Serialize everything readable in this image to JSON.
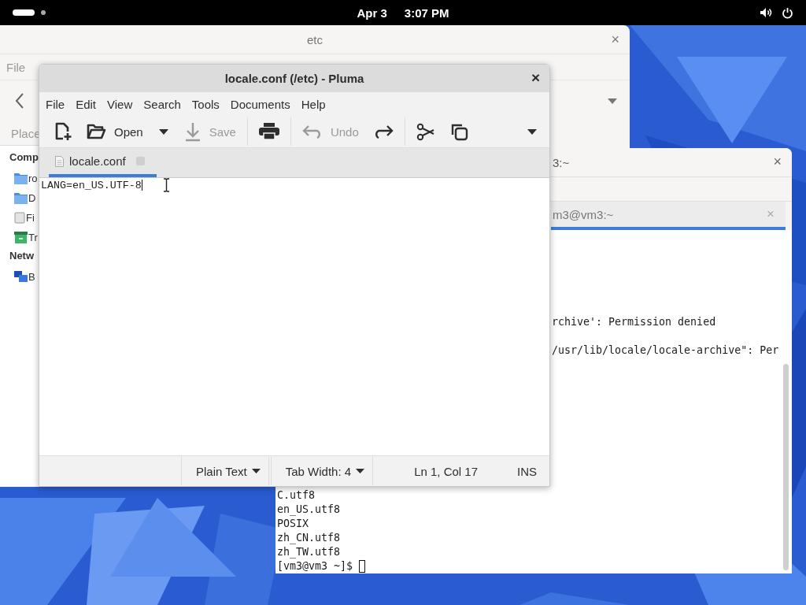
{
  "top_bar": {
    "date": "Apr 3",
    "time": "3:07 PM"
  },
  "close_glyph": "×",
  "file_manager": {
    "title": "etc",
    "menu": [
      "File"
    ],
    "places_label": "Place",
    "sidebar": [
      {
        "kind": "heading",
        "label": "Comp"
      },
      {
        "kind": "item",
        "label": "ro"
      },
      {
        "kind": "item",
        "label": "D"
      },
      {
        "kind": "item",
        "label": "Fi"
      },
      {
        "kind": "item",
        "label": "Tr"
      },
      {
        "kind": "heading",
        "label": "Netw"
      },
      {
        "kind": "item",
        "label": "B"
      }
    ]
  },
  "terminal": {
    "title": "3:~",
    "tab": {
      "label": "m3@vm3:~",
      "selected": true
    },
    "upper_lines": [
      "rchive': Permission denied",
      "/usr/lib/locale/locale-archive\": Per"
    ],
    "lower_lines": [
      "C.utf8",
      "en_US.utf8",
      "POSIX",
      "zh_CN.utf8",
      "zh_TW.utf8"
    ],
    "prompt": "[vm3@vm3 ~]$"
  },
  "editor": {
    "title": "locale.conf (/etc) - Pluma",
    "menu": [
      "File",
      "Edit",
      "View",
      "Search",
      "Tools",
      "Documents",
      "Help"
    ],
    "toolbar": {
      "open": {
        "label": "Open",
        "disabled": false
      },
      "save": {
        "label": "Save",
        "disabled": true
      },
      "undo": {
        "label": "Undo",
        "disabled": true
      },
      "redo": {
        "disabled": false
      }
    },
    "tabs": [
      {
        "label": "locale.conf",
        "selected": true
      }
    ],
    "lines": [
      "LANG=en_US.UTF-8"
    ],
    "status": {
      "language": "Plain Text",
      "tab_width": "Tab Width: 4",
      "position": "Ln 1, Col 17",
      "mode": "INS"
    }
  }
}
